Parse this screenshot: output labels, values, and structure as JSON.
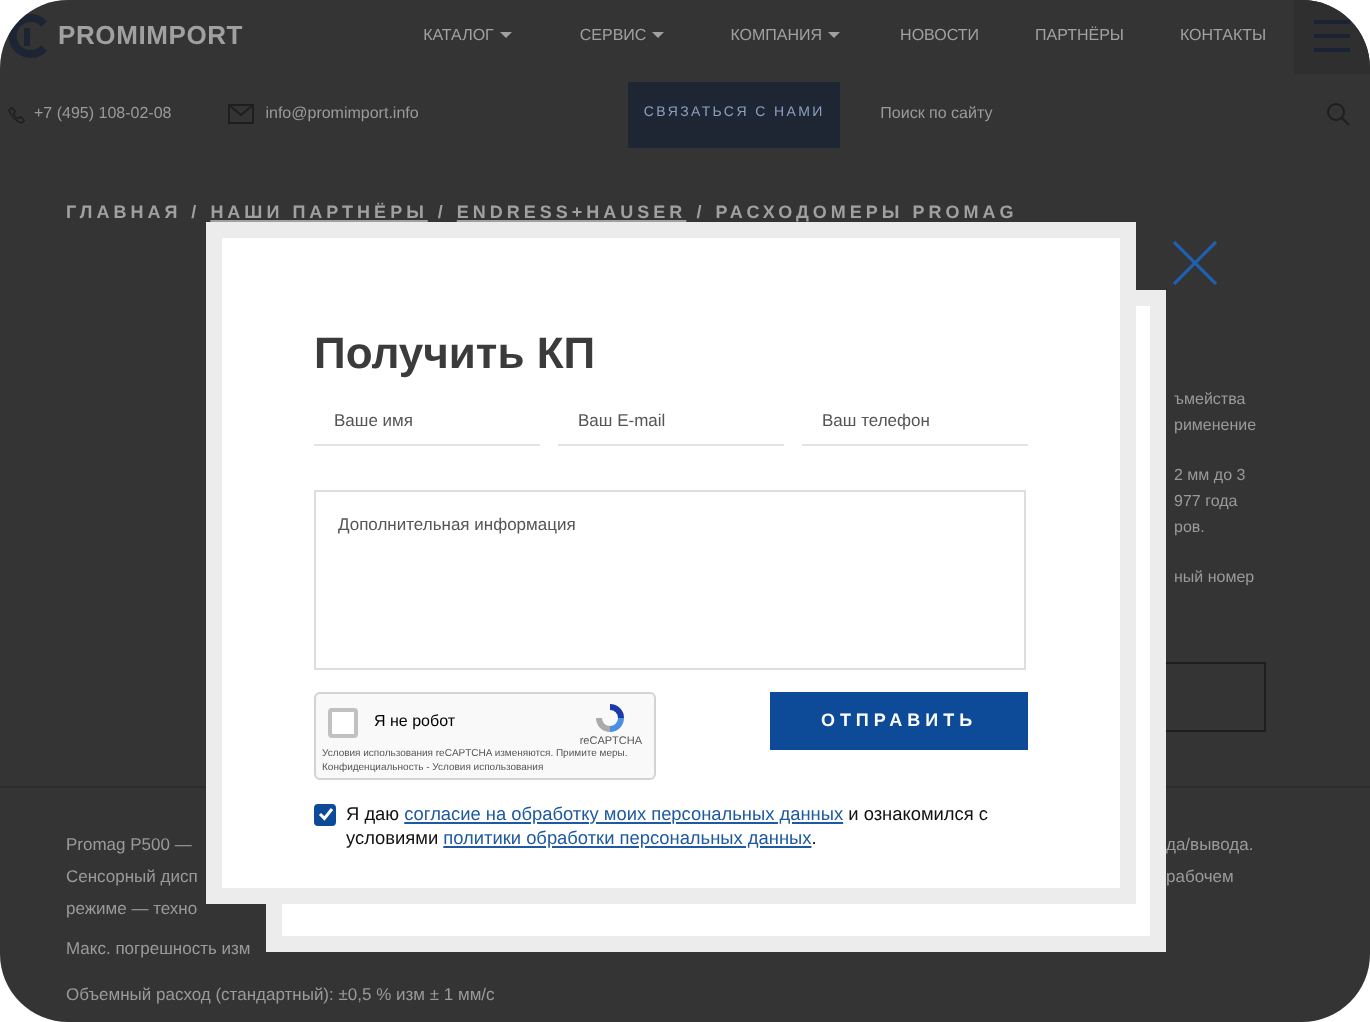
{
  "header": {
    "logo": "PROMIMPORT",
    "nav": [
      {
        "label": "КАТАЛОГ",
        "dropdown": true
      },
      {
        "label": "СЕРВИС",
        "dropdown": true
      },
      {
        "label": "КОМПАНИЯ",
        "dropdown": true
      },
      {
        "label": "НОВОСТИ",
        "dropdown": false
      },
      {
        "label": "ПАРТНЁРЫ",
        "dropdown": false
      },
      {
        "label": "КОНТАКТЫ",
        "dropdown": false
      }
    ],
    "phone": "+7 (495) 108-02-08",
    "email": "info@promimport.info",
    "contact_button": "СВЯЗАТЬСЯ С НАМИ",
    "search": {
      "placeholder": "Поиск по сайту"
    }
  },
  "breadcrumb": {
    "separator": "/",
    "items": [
      "ГЛАВНАЯ",
      "НАШИ ПАРТНЁРЫ",
      "ENDRESS+HAUSER",
      "РАСХОДОМЕРЫ PROMAG"
    ]
  },
  "side_text": [
    [
      "ъмейства",
      "рименение"
    ],
    [
      "2 мм до 3",
      "977 года",
      "ров."
    ],
    [
      "ный номер"
    ]
  ],
  "body_text": [
    {
      "left": "Promag P500 —",
      "right": "да/вывода."
    },
    {
      "left": "Сенсорный дисп",
      "right": "рабочем"
    },
    {
      "left": "режиме — техно"
    }
  ],
  "specs": [
    "Макс. погрешность изм",
    "Объемный расход (стандартный): ±0,5 % изм ± 1 мм/с"
  ],
  "modal": {
    "title": "Получить КП",
    "fields": [
      {
        "placeholder": "Ваше имя"
      },
      {
        "placeholder": "Ваш E-mail"
      },
      {
        "placeholder": "Ваш телефон"
      }
    ],
    "textarea": {
      "placeholder": "Дополнительная информация"
    },
    "captcha": {
      "label": "Я не робот",
      "checked": false,
      "brand": "reCAPTCHA",
      "notice": "Условия использования reCAPTCHA изменяются. Примите меры.",
      "links": "Конфиденциальность - Условия использования"
    },
    "submit": "ОТПРАВИТЬ",
    "consent": {
      "checked": true,
      "before": "Я даю ",
      "link_1": "согласие на обработку моих персональных данных",
      "middle": " и ознакомился с условиями ",
      "link_2": "политики обработки персональных данных",
      "after": "."
    }
  }
}
